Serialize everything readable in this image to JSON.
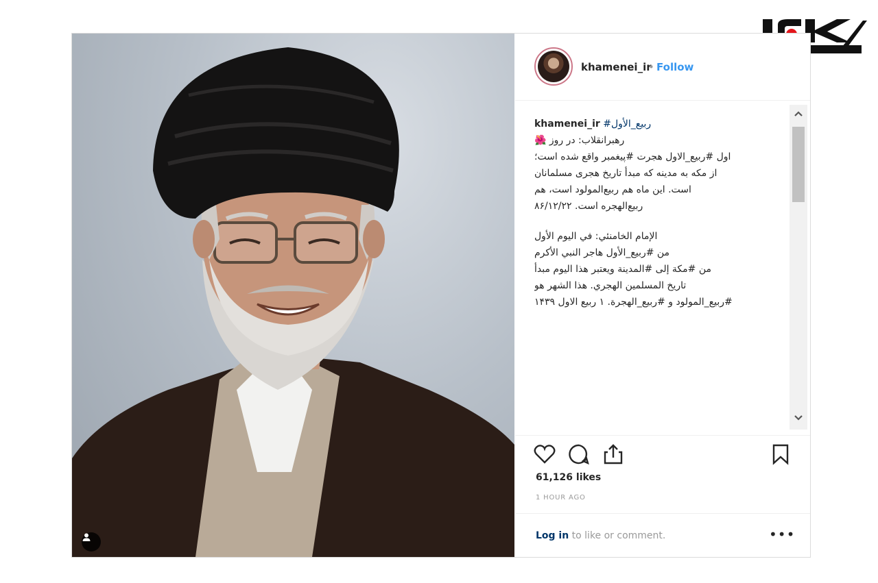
{
  "post": {
    "username": "khamenei_ir",
    "separator": "•",
    "follow_label": "Follow",
    "caption": {
      "user": "khamenei_ir",
      "hashtag": "#ربیع_الأول",
      "lines": [
        "رهبرانقلاب: در روز 🌺",
        "اول #ربیع_الاول هجرت #پیغمبر واقع شده است؛",
        "از مکه به مدینه که مبدأ تاریخ هجری مسلمانان",
        "است. این ماه هم ربیع‌المولود است، هم",
        "ربیع‌الهجره است. ۸۶/۱۲/۲۲",
        "",
        "الإمام الخامنئي: في اليوم الأول",
        "من #ربيع_الأول هاجر النبي الأكرم",
        "من #مكة إلى #المدينة ويعتبر هذا اليوم مبدأ",
        "تاريخ المسلمين الهجري. هذا الشهر هو",
        "#ربيع_المولود و #ربيع_الهجرة. ۱ ربیع الاول ۱۴۳۹"
      ]
    },
    "likes": "61,126 likes",
    "time": "1 HOUR AGO",
    "login_link": "Log in",
    "login_rest": " to like or comment.",
    "more": "•••"
  },
  "icons": {
    "like": "heart-icon",
    "comment": "comment-icon",
    "share": "share-icon",
    "save": "bookmark-icon",
    "user_tag": "user-tag-icon"
  },
  "colors": {
    "link": "#3897f0",
    "logo": "#e4161c"
  }
}
